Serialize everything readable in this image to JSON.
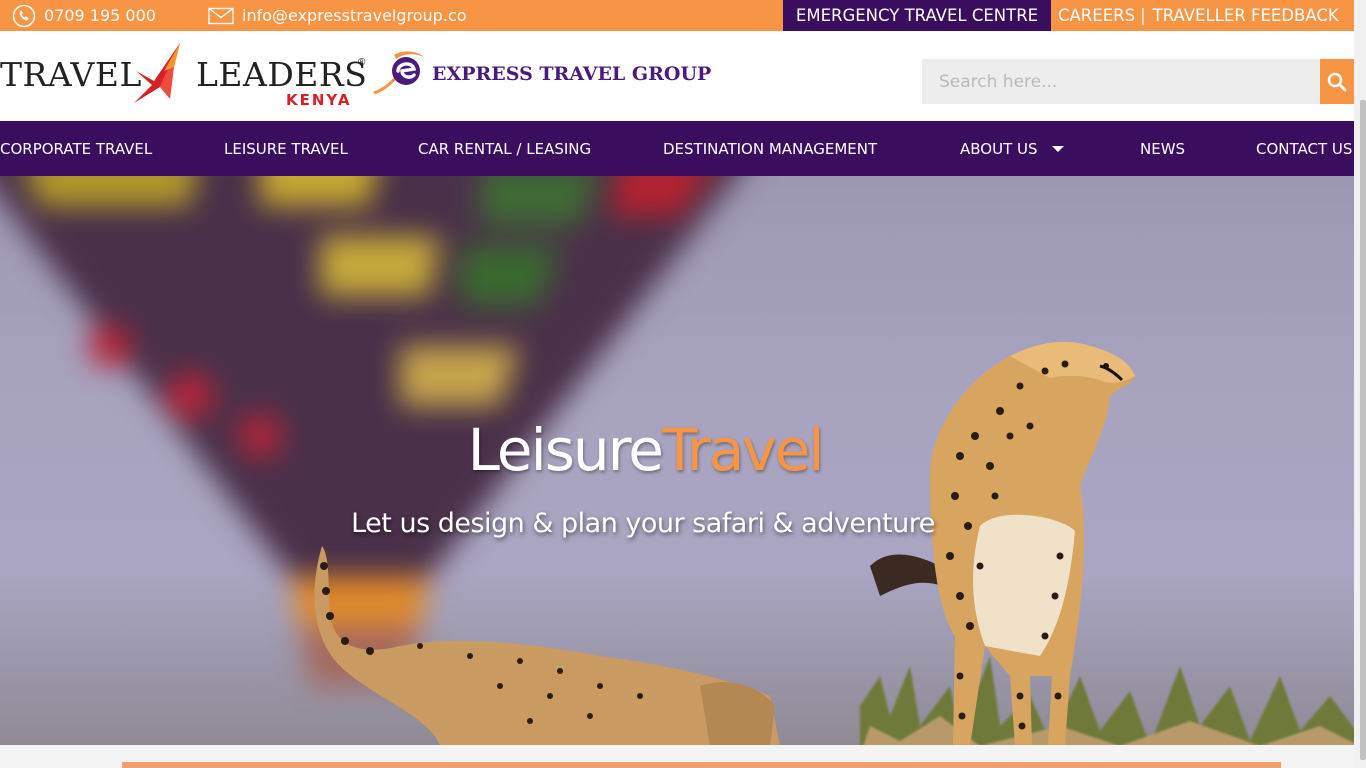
{
  "topbar": {
    "phone": "0709 195 000",
    "email": "info@expresstravelgroup.co",
    "emergency": "EMERGENCY TRAVEL CENTRE",
    "careers": "CAREERS",
    "separator": "|",
    "feedback": "TRAVELLER FEEDBACK"
  },
  "header": {
    "logo_travel": "TRAVEL",
    "logo_leaders": "LEADERS",
    "logo_reg": "®",
    "logo_kenya": "KENYA",
    "logo_express": "EXPRESS TRAVEL GROUP",
    "search_placeholder": "Search here..."
  },
  "nav": {
    "items": [
      "CORPORATE TRAVEL",
      "LEISURE TRAVEL",
      "CAR RENTAL / LEASING",
      "DESTINATION MANAGEMENT",
      "ABOUT US",
      "NEWS",
      "CONTACT US"
    ]
  },
  "hero": {
    "title_white": "Leisure",
    "title_orange": "Travel",
    "subtitle": "Let us design & plan your safari & adventure"
  },
  "colors": {
    "orange": "#f79545",
    "purple": "#3a0d5e",
    "kenya_red": "#d42027"
  },
  "icons": [
    "phone-icon",
    "mail-icon",
    "search-icon",
    "chevron-down-icon"
  ]
}
